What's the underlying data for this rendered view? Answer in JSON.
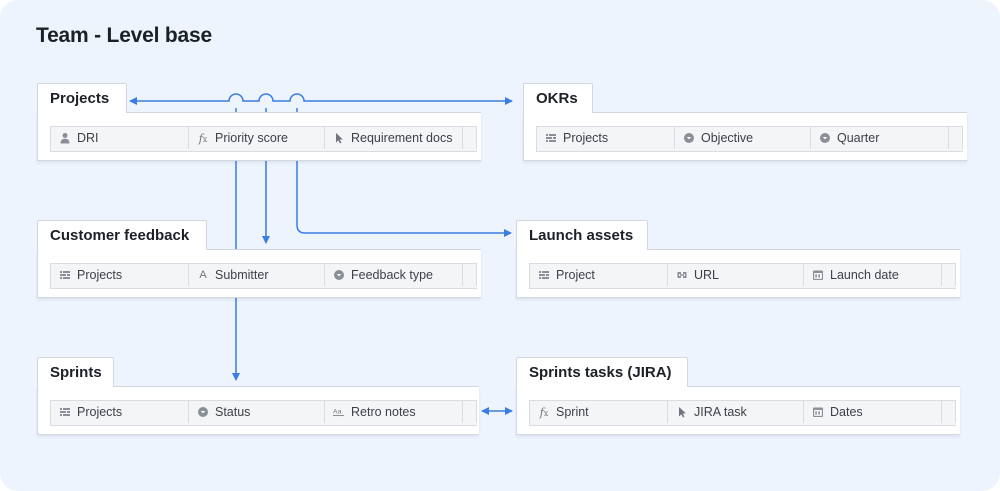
{
  "page": {
    "title": "Team - Level base"
  },
  "colors": {
    "connector": "#3b7de3",
    "background": "#eef4fe"
  },
  "tables": [
    {
      "id": "projects",
      "name": "Projects",
      "fields": [
        {
          "label": "DRI",
          "icon": "person-icon"
        },
        {
          "label": "Priority score",
          "icon": "formula-icon"
        },
        {
          "label": "Requirement docs",
          "icon": "cursor-icon"
        }
      ]
    },
    {
      "id": "okrs",
      "name": "OKRs",
      "fields": [
        {
          "label": "Projects",
          "icon": "link-record-icon"
        },
        {
          "label": "Objective",
          "icon": "single-select-icon"
        },
        {
          "label": "Quarter",
          "icon": "single-select-icon"
        }
      ]
    },
    {
      "id": "customer-feedback",
      "name": "Customer feedback",
      "fields": [
        {
          "label": "Projects",
          "icon": "link-record-icon"
        },
        {
          "label": "Submitter",
          "icon": "text-icon"
        },
        {
          "label": "Feedback type",
          "icon": "single-select-icon"
        }
      ]
    },
    {
      "id": "launch-assets",
      "name": "Launch assets",
      "fields": [
        {
          "label": "Project",
          "icon": "link-record-icon"
        },
        {
          "label": "URL",
          "icon": "url-icon"
        },
        {
          "label": "Launch date",
          "icon": "calendar-icon"
        }
      ]
    },
    {
      "id": "sprints",
      "name": "Sprints",
      "fields": [
        {
          "label": "Projects",
          "icon": "link-record-icon"
        },
        {
          "label": "Status",
          "icon": "single-select-icon"
        },
        {
          "label": "Retro notes",
          "icon": "long-text-icon"
        }
      ]
    },
    {
      "id": "sprints-tasks",
      "name": "Sprints tasks (JIRA)",
      "fields": [
        {
          "label": "Sprint",
          "icon": "formula-icon"
        },
        {
          "label": "JIRA task",
          "icon": "cursor-icon"
        },
        {
          "label": "Dates",
          "icon": "calendar-icon"
        }
      ]
    }
  ],
  "connections": [
    {
      "from": "projects",
      "to": "okrs",
      "arrows": "both"
    },
    {
      "from": "projects",
      "to": "customer-feedback",
      "arrows": "end"
    },
    {
      "from": "projects",
      "to": "launch-assets",
      "arrows": "end"
    },
    {
      "from": "projects",
      "to": "sprints",
      "arrows": "end"
    },
    {
      "from": "sprints",
      "to": "sprints-tasks",
      "arrows": "both"
    }
  ]
}
